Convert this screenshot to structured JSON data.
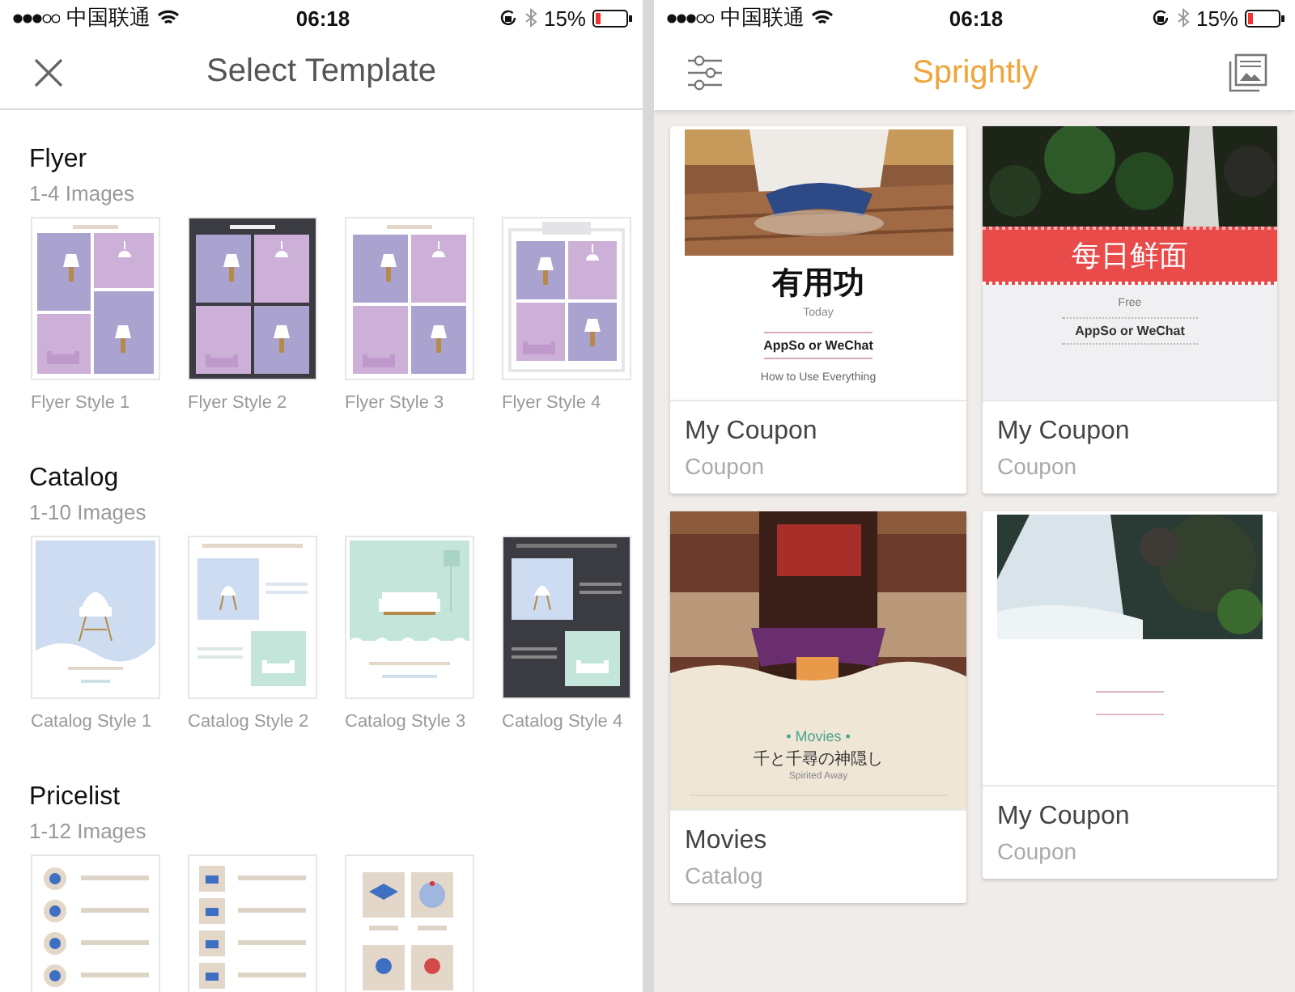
{
  "left_screen": {
    "status_bar": {
      "carrier": "中国联通",
      "time": "06:18",
      "battery": "15%"
    },
    "title": "Select Template",
    "sections": [
      {
        "title": "Flyer",
        "subtitle": "1-4 Images",
        "templates": [
          {
            "label": "Flyer Style 1",
            "kind": "flyer-mosaic",
            "dark": false
          },
          {
            "label": "Flyer Style 2",
            "kind": "flyer-grid",
            "dark": true
          },
          {
            "label": "Flyer Style 3",
            "kind": "flyer-grid",
            "dark": false
          },
          {
            "label": "Flyer Style 4",
            "kind": "flyer-framed",
            "dark": false
          }
        ]
      },
      {
        "title": "Catalog",
        "subtitle": "1-10 Images",
        "templates": [
          {
            "label": "Catalog Style 1",
            "kind": "catalog-hero",
            "dark": false
          },
          {
            "label": "Catalog Style 2",
            "kind": "catalog-split",
            "dark": false
          },
          {
            "label": "Catalog Style 3",
            "kind": "catalog-sofa",
            "dark": false
          },
          {
            "label": "Catalog Style 4",
            "kind": "catalog-split",
            "dark": true
          }
        ]
      },
      {
        "title": "Pricelist",
        "subtitle": "1-12 Images",
        "templates": [
          {
            "kind": "price-circles",
            "dark": false
          },
          {
            "kind": "price-squares",
            "dark": false
          },
          {
            "kind": "price-grid",
            "dark": false
          }
        ]
      }
    ]
  },
  "right_screen": {
    "status_bar": {
      "carrier": "中国联通",
      "time": "06:18",
      "battery": "15%"
    },
    "title": "Sprightly",
    "columns": [
      {
        "cards": [
          {
            "name": "My Coupon",
            "category": "Coupon",
            "preview": {
              "kind": "coupon-photo",
              "lines": [
                "有用功",
                "Today",
                "AppSo or WeChat",
                "How to Use Everything"
              ]
            }
          },
          {
            "name": "Movies",
            "category": "Catalog",
            "preview": {
              "kind": "movie",
              "lines": [
                "• Movies •",
                "千と千尋の神隠し",
                "Spirited Away"
              ]
            }
          }
        ]
      },
      {
        "cards": [
          {
            "name": "My Coupon",
            "category": "Coupon",
            "preview": {
              "kind": "banner",
              "lines": [
                "每日鲜面",
                "Free",
                "AppSo or WeChat"
              ]
            }
          },
          {
            "name": "My Coupon",
            "category": "Coupon",
            "preview": {
              "kind": "lines"
            }
          }
        ]
      }
    ]
  }
}
